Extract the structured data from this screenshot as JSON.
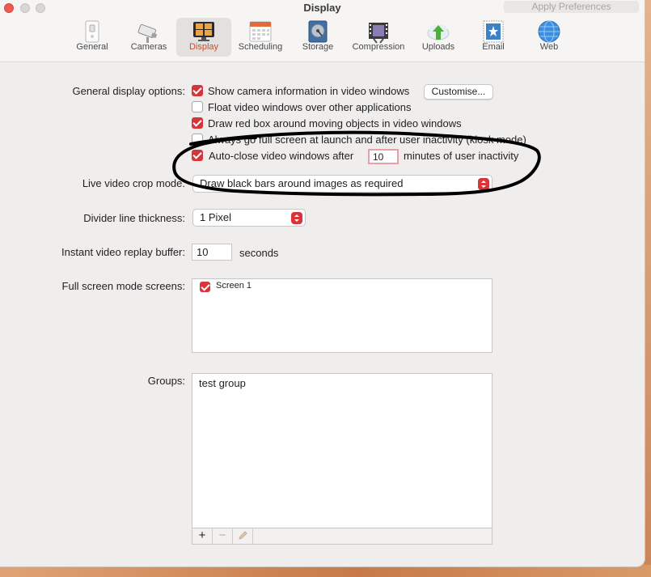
{
  "window": {
    "title": "Display",
    "apply_label": "Apply Preferences"
  },
  "toolbar": {
    "items": [
      {
        "label": "General",
        "icon": "general-icon"
      },
      {
        "label": "Cameras",
        "icon": "camera-icon"
      },
      {
        "label": "Display",
        "icon": "display-icon",
        "active": true
      },
      {
        "label": "Scheduling",
        "icon": "calendar-icon"
      },
      {
        "label": "Storage",
        "icon": "hard-disk-icon"
      },
      {
        "label": "Compression",
        "icon": "film-icon"
      },
      {
        "label": "Uploads",
        "icon": "upload-cloud-icon"
      },
      {
        "label": "Email",
        "icon": "email-stamp-icon"
      },
      {
        "label": "Web",
        "icon": "globe-icon"
      }
    ]
  },
  "general_display": {
    "label": "General display options:",
    "options": [
      {
        "label": "Show camera information in video windows",
        "checked": true
      },
      {
        "label": "Float video windows over other applications",
        "checked": false
      },
      {
        "label": "Draw red box around moving objects in video windows",
        "checked": true
      },
      {
        "label": "Always go full screen at launch and after user inactivity (kiosk mode)",
        "checked": false
      },
      {
        "label_before": "Auto-close video windows after",
        "value": "10",
        "label_after": "minutes of user inactivity",
        "checked": true
      }
    ],
    "customise_label": "Customise..."
  },
  "crop_mode": {
    "label": "Live video crop mode:",
    "value": "Draw black bars around images as required"
  },
  "divider": {
    "label": "Divider line thickness:",
    "value": "1 Pixel"
  },
  "replay_buffer": {
    "label": "Instant video replay buffer:",
    "value": "10",
    "unit": "seconds"
  },
  "fullscreen_screens": {
    "label": "Full screen mode screens:",
    "items": [
      {
        "label": "Screen 1",
        "checked": true
      }
    ]
  },
  "groups": {
    "label": "Groups:",
    "items": [
      "test group"
    ],
    "add_symbol": "+",
    "remove_symbol": "−"
  },
  "colors": {
    "accent": "#d8343a",
    "active_tab_text": "#cc4b2c",
    "window_bg": "#f0eeed",
    "annotation": "#000000"
  }
}
